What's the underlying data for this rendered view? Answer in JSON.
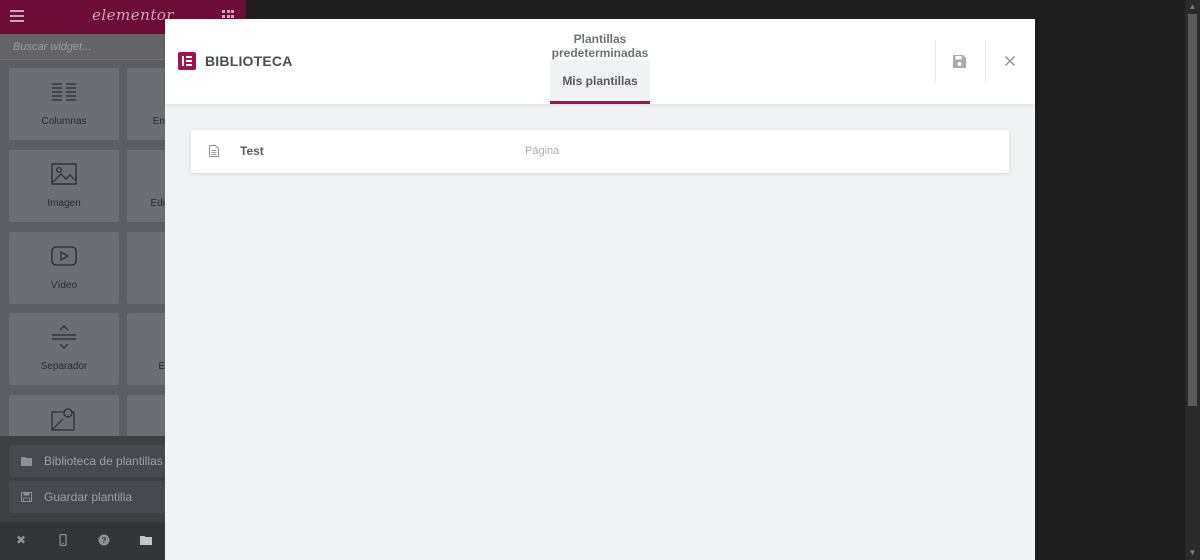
{
  "panel": {
    "logo": "elementor",
    "search_placeholder": "Buscar widget...",
    "widgets": [
      {
        "label": "Columnas",
        "icon": "columns-icon"
      },
      {
        "label": "Imagen",
        "icon": "image-icon"
      },
      {
        "label": "Vídeo",
        "icon": "video-icon"
      },
      {
        "label": "Separador",
        "icon": "divider-icon"
      },
      {
        "label": "",
        "icon": "map-icon"
      }
    ],
    "widgets_right_partial": [
      "En",
      "Edi",
      "",
      "E",
      ""
    ],
    "template_menu": [
      {
        "label": "Biblioteca de plantillas",
        "icon": "folder-icon"
      },
      {
        "label": "Guardar plantilla",
        "icon": "save-icon"
      }
    ],
    "footer_icons": [
      "close-icon",
      "mobile-icon",
      "help-icon",
      "folder-icon"
    ]
  },
  "modal": {
    "title": "BIBLIOTECA",
    "tabs": [
      {
        "label": "Plantillas predeterminadas",
        "active": false
      },
      {
        "label": "Mis plantillas",
        "active": true
      }
    ],
    "actions": [
      "save-icon",
      "close-icon"
    ],
    "templates": [
      {
        "name": "Test",
        "type": "Página"
      }
    ]
  },
  "colors": {
    "brand": "#a4114f",
    "panel_header": "#6b0d36",
    "backdrop": "#1e1e1e",
    "modal_body": "#f1f2f4"
  }
}
